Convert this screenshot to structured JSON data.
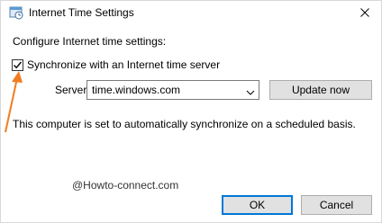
{
  "window": {
    "title": "Internet Time Settings",
    "icon": "clock-globe-icon",
    "close_icon": "close-icon"
  },
  "main": {
    "heading": "Configure Internet time settings:",
    "sync_checkbox": {
      "label": "Synchronize with an Internet time server",
      "checked": true
    },
    "server": {
      "label": "Server:",
      "value": "time.windows.com"
    },
    "update_button": "Update now",
    "status": "This computer is set to automatically synchronize on a scheduled basis.",
    "watermark": "@Howto-connect.com"
  },
  "footer": {
    "ok_label": "OK",
    "cancel_label": "Cancel"
  },
  "colors": {
    "accent": "#0078d7",
    "annotation_arrow": "#f07c22",
    "button_bg": "#e1e1e1"
  }
}
